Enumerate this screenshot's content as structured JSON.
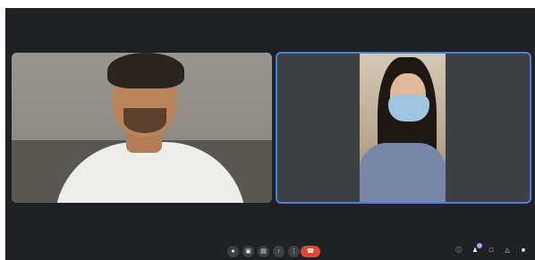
{
  "participants": [
    {
      "name": ""
    },
    {
      "name": ""
    }
  ],
  "bottom_bar": {
    "time": "",
    "meeting_code": ""
  },
  "controls": {
    "mic_icon": "mic-icon",
    "camera_icon": "camera-icon",
    "captions_icon": "captions-icon",
    "present_icon": "present-icon",
    "more_icon": "more-icon",
    "leave_icon": "call-end-icon"
  },
  "side_panel": {
    "people_count": ""
  },
  "colors": {
    "stage_bg": "#202124",
    "active_speaker_border": "#4f7fd8",
    "leave_button": "#ea4335"
  }
}
